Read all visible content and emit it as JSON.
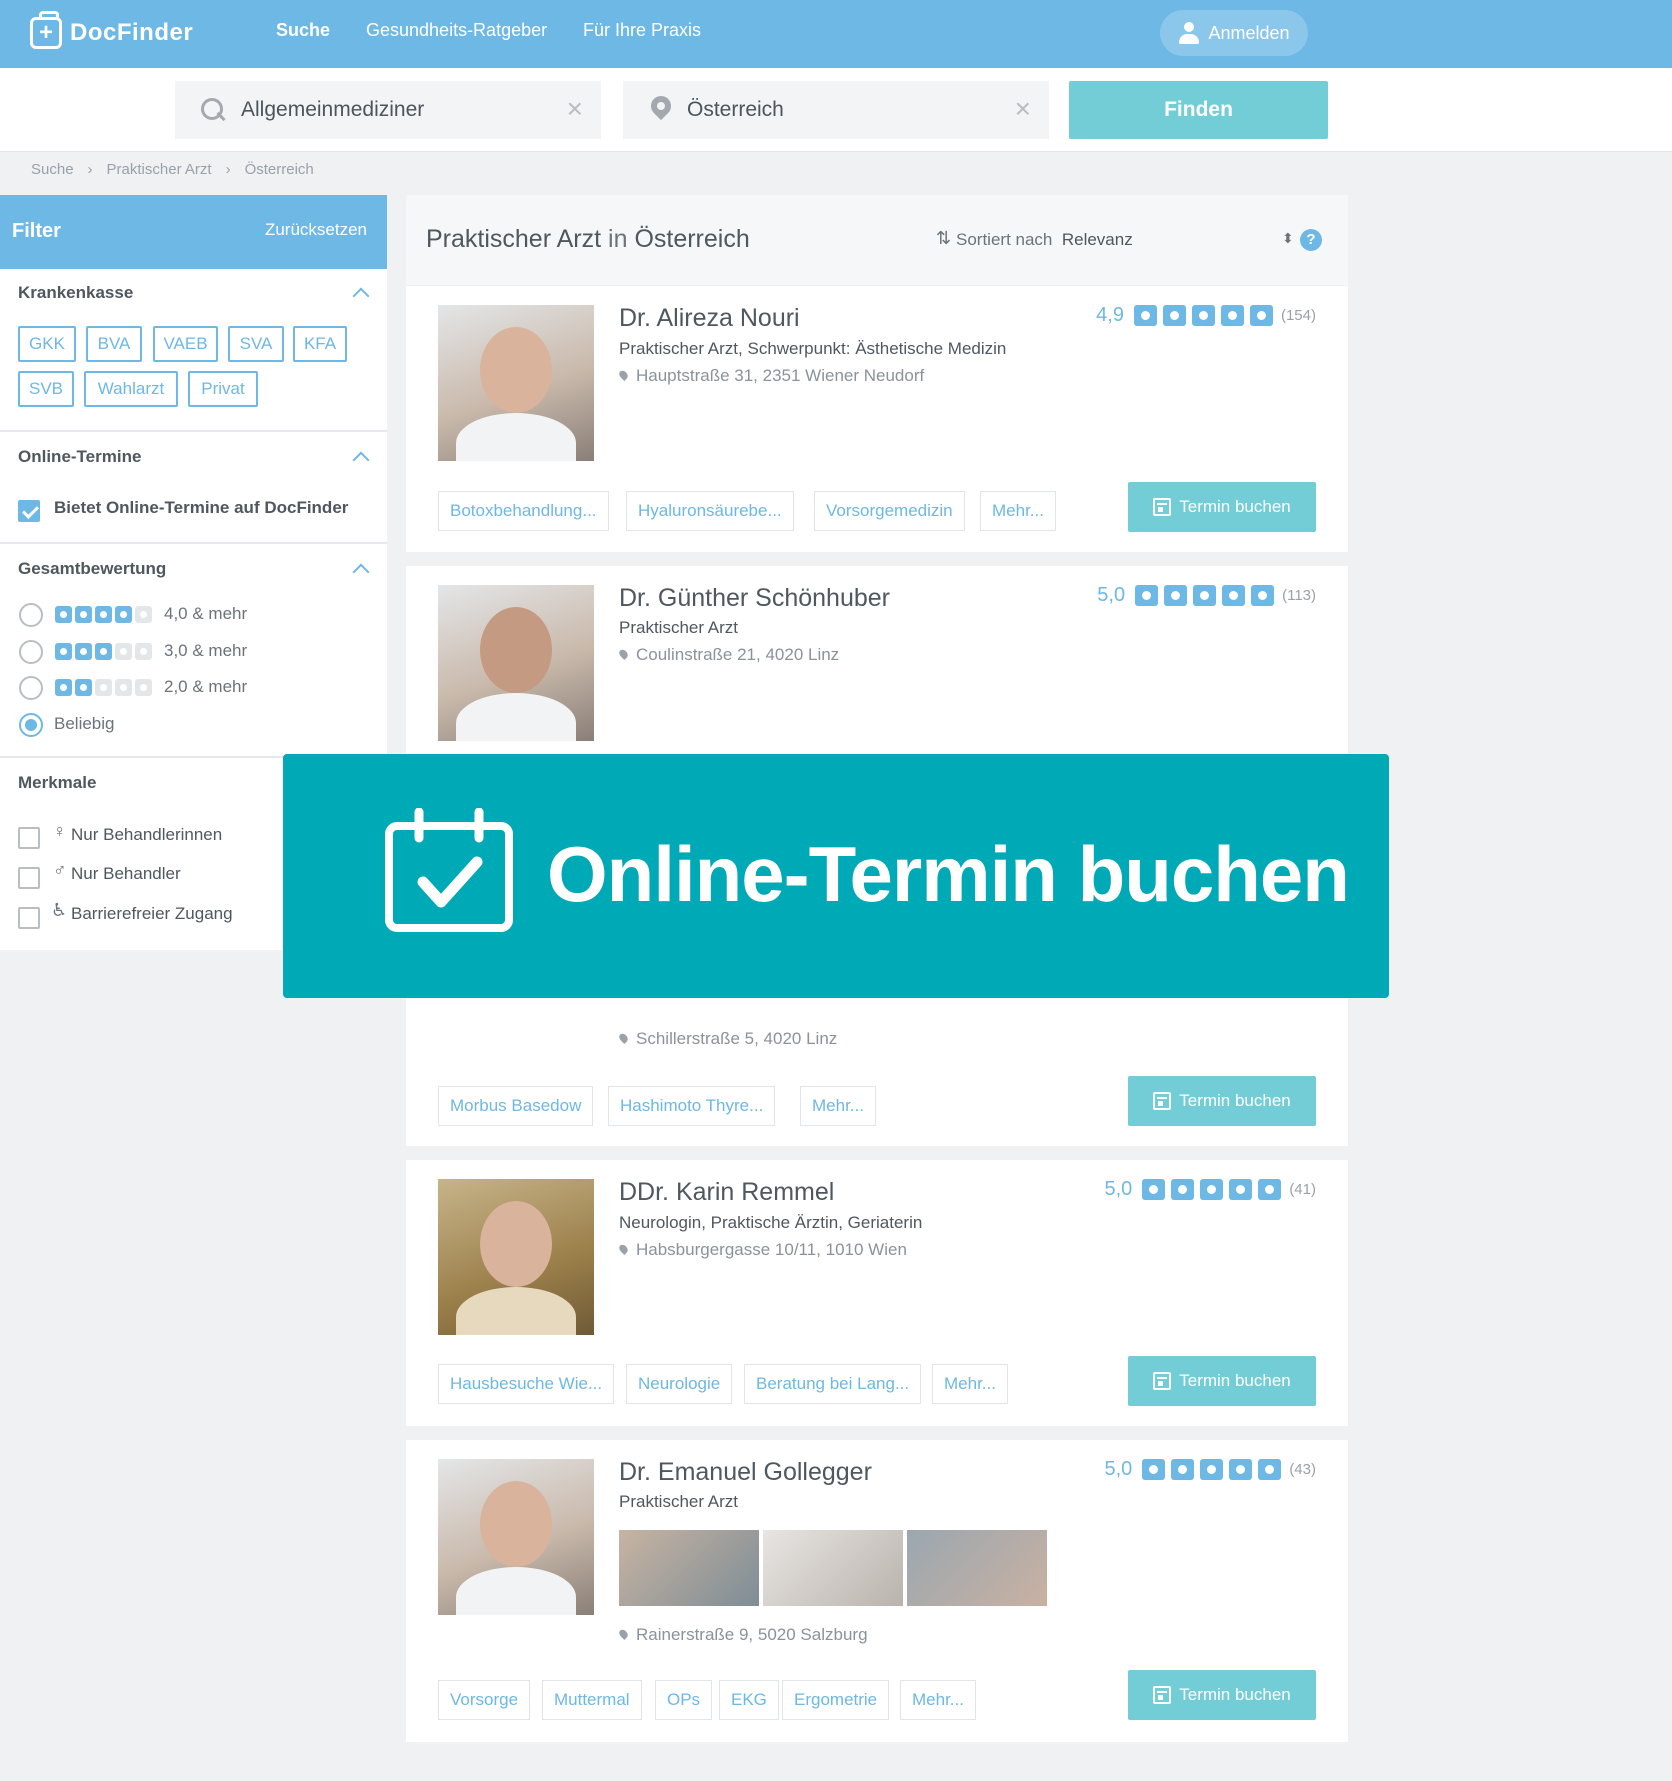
{
  "header": {
    "logo_letter": "+",
    "logo": "DocFinder",
    "nav": [
      "Suche",
      "Gesundheits-Ratgeber",
      "Für Ihre Praxis"
    ],
    "login": "Anmelden"
  },
  "search": {
    "query": "Allgemeinmediziner",
    "location": "Österreich",
    "clear_glyph": "×",
    "button": "Finden"
  },
  "breadcrumb": [
    "Suche",
    "Praktischer Arzt",
    "Österreich"
  ],
  "breadcrumb_sep": "›",
  "filter": {
    "title": "Filter",
    "reset": "Zurücksetzen",
    "insurance": {
      "title": "Krankenkasse",
      "tags": [
        "GKK",
        "BVA",
        "VAEB",
        "SVA",
        "KFA",
        "SVB",
        "Wahlarzt",
        "Privat"
      ]
    },
    "online": {
      "title": "Online-Termine",
      "checkbox_label": "Bietet Online-Termine auf DocFinder",
      "checked": true
    },
    "rating": {
      "title": "Gesamtbewertung",
      "options": [
        {
          "label": "4,0 & mehr",
          "stars": 4
        },
        {
          "label": "3,0 & mehr",
          "stars": 3
        },
        {
          "label": "2,0 & mehr",
          "stars": 2
        },
        {
          "label": "Beliebig",
          "stars": 0
        }
      ],
      "selected": 3
    },
    "features": {
      "title": "Merkmale",
      "items": [
        {
          "icon": "female-person-icon",
          "label": "Nur Behandlerinnen"
        },
        {
          "icon": "male-person-icon",
          "label": "Nur Behandler"
        },
        {
          "icon": "wheelchair-icon",
          "label": "Barrierefreier Zugang"
        }
      ]
    }
  },
  "results": {
    "title_main": "Praktischer Arzt",
    "title_in": "in",
    "title_place": "Österreich",
    "sort_label": "Sortiert nach",
    "sort_value": "Relevanz",
    "sort_arrows": "⇅",
    "sort_select": "⬍",
    "help": "?",
    "book_label": "Termin buchen",
    "doctors": [
      {
        "name": "Dr. Alireza Nouri",
        "specialty": "Praktischer Arzt, Schwerpunkt: Ästhetische Medizin",
        "address": "Hauptstraße 31, 2351 Wiener Neudorf",
        "score": "4,9",
        "count": "(154)",
        "tags": [
          "Botoxbehandlung...",
          "Hyaluronsäurebe...",
          "Vorsorgemedizin",
          "Mehr..."
        ]
      },
      {
        "name": "Dr. Günther Schönhuber",
        "specialty": "Praktischer Arzt",
        "address": "Coulinstraße 21, 4020 Linz",
        "score": "5,0",
        "count": "(113)",
        "tags": []
      },
      {
        "name": "",
        "specialty": "",
        "address": "Schillerstraße 5, 4020 Linz",
        "score": "",
        "count": "",
        "tags": [
          "Morbus Basedow",
          "Hashimoto Thyre...",
          "Mehr..."
        ]
      },
      {
        "name": "DDr. Karin Remmel",
        "specialty": "Neurologin, Praktische Ärztin, Geriaterin",
        "address": "Habsburgergasse 10/11, 1010 Wien",
        "score": "5,0",
        "count": "(41)",
        "tags": [
          "Hausbesuche Wie...",
          "Neurologie",
          "Beratung bei Lang...",
          "Mehr..."
        ]
      },
      {
        "name": "Dr. Emanuel Gollegger",
        "specialty": "Praktischer Arzt",
        "address": "Rainerstraße 9, 5020 Salzburg",
        "score": "5,0",
        "count": "(43)",
        "tags": [
          "Vorsorge",
          "Muttermal",
          "OPs",
          "EKG",
          "Ergometrie",
          "Mehr..."
        ]
      }
    ]
  },
  "banner": {
    "text": "Online-Termin buchen",
    "icon": "calendar-check-icon"
  },
  "colors": {
    "brand": "#6db8e4",
    "action": "#72cdd7",
    "banner": "#00a9b6"
  }
}
